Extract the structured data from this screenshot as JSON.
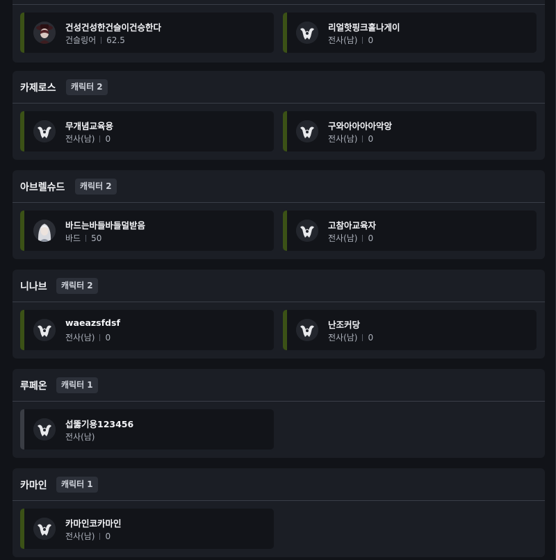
{
  "top_group": {
    "characters": [
      {
        "name": "건성건성한건슬이건승한다",
        "class": "건슬링어",
        "level": "62.5",
        "avatar": "gunslinger-portrait",
        "accent": "#3b5116"
      },
      {
        "name": "리얼핫핑크홀나게이",
        "class": "전사(남)",
        "level": "0",
        "avatar": "warrior-emblem",
        "accent": "#3b5116"
      }
    ]
  },
  "groups": [
    {
      "server": "카제로스",
      "count_label": "캐릭터 2",
      "characters": [
        {
          "name": "무개념교육용",
          "class": "전사(남)",
          "level": "0",
          "avatar": "warrior-emblem"
        },
        {
          "name": "구와아아아아악앙",
          "class": "전사(남)",
          "level": "0",
          "avatar": "warrior-emblem"
        }
      ]
    },
    {
      "server": "아브렐슈드",
      "count_label": "캐릭터 2",
      "characters": [
        {
          "name": "바드는바들바들덜받음",
          "class": "바드",
          "level": "50",
          "avatar": "bard-portrait"
        },
        {
          "name": "고참아교육자",
          "class": "전사(남)",
          "level": "0",
          "avatar": "warrior-emblem"
        }
      ]
    },
    {
      "server": "니나브",
      "count_label": "캐릭터 2",
      "characters": [
        {
          "name": "waeazsfdsf",
          "class": "전사(남)",
          "level": "0",
          "avatar": "warrior-emblem"
        },
        {
          "name": "난조커당",
          "class": "전사(남)",
          "level": "0",
          "avatar": "warrior-emblem"
        }
      ]
    },
    {
      "server": "루페온",
      "count_label": "캐릭터 1",
      "characters": [
        {
          "name": "섭뚫기용123456",
          "class": "전사(남)",
          "level": "",
          "avatar": "warrior-emblem"
        }
      ]
    },
    {
      "server": "카마인",
      "count_label": "캐릭터 1",
      "characters": [
        {
          "name": "카마인코카마인",
          "class": "전사(남)",
          "level": "0",
          "avatar": "warrior-emblem"
        }
      ]
    }
  ],
  "colors": {
    "accent_green": "#3b5116",
    "accent_gray": "#3a3d44",
    "panel": "#1b1e25",
    "card": "#121419",
    "background": "#111318"
  }
}
